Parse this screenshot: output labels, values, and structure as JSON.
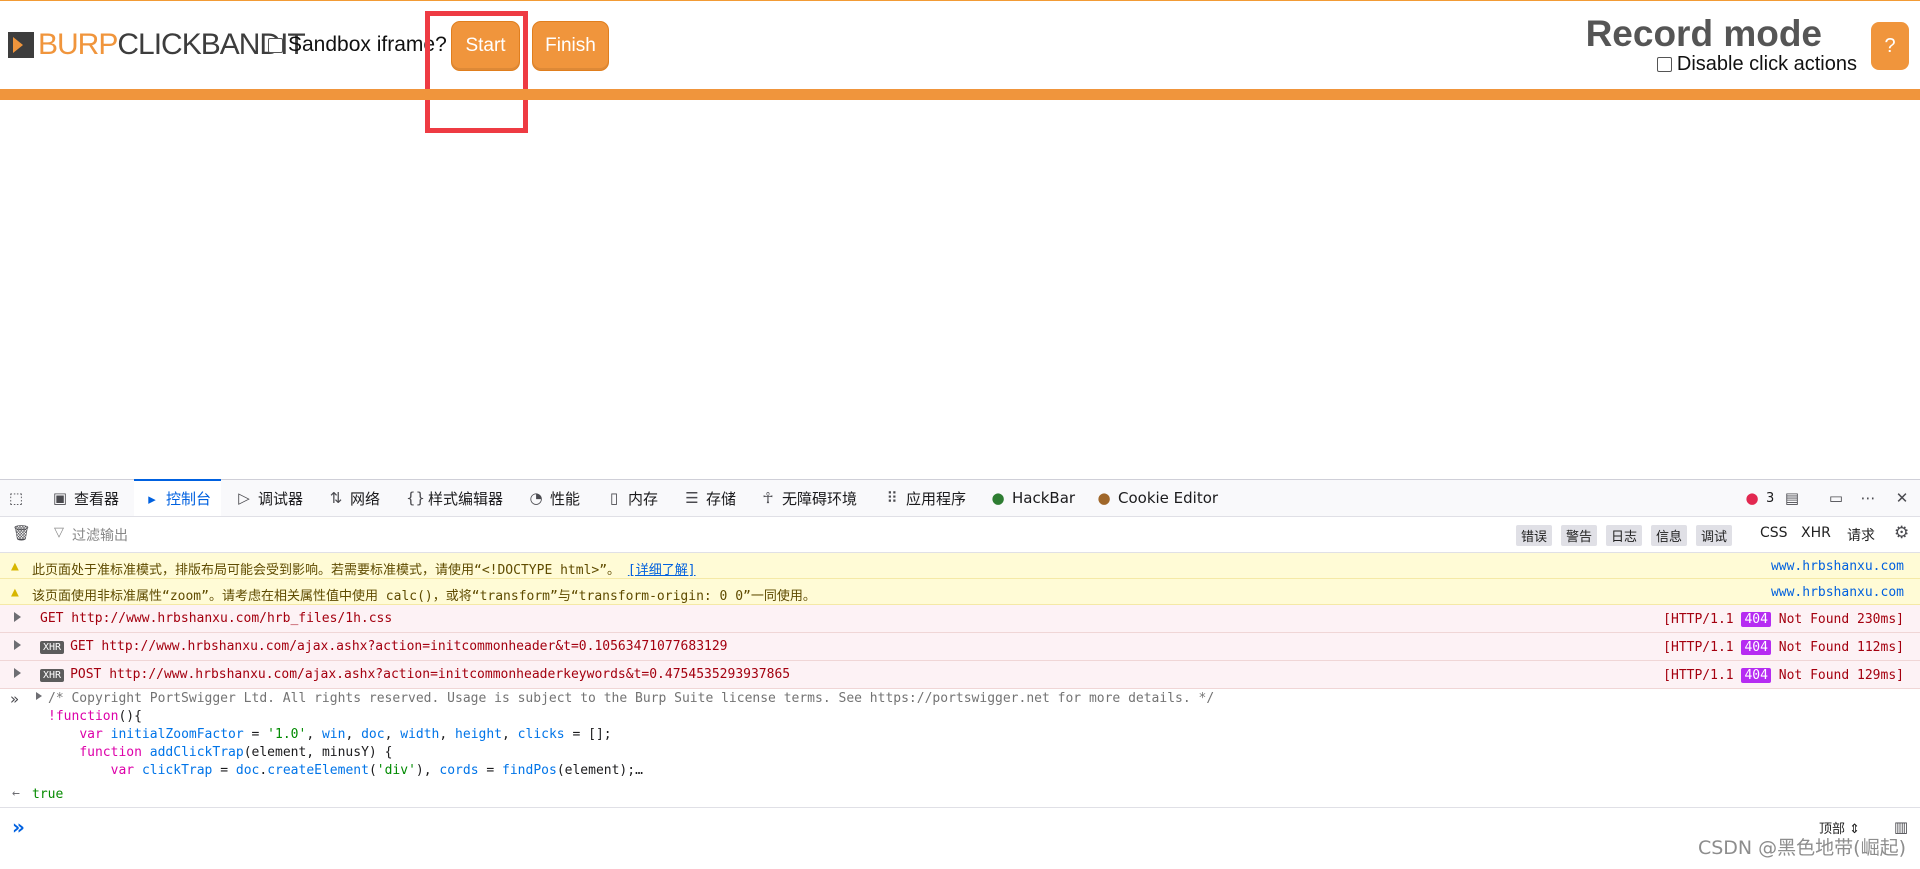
{
  "clickbandit": {
    "logo_part1": "BURP",
    "logo_part2": "CLICKBANDIT",
    "sandbox_label": "Sandbox iframe?",
    "start_label": "Start",
    "finish_label": "Finish",
    "mode_title": "Record mode",
    "disable_label": "Disable click actions",
    "help_label": "?"
  },
  "devtools": {
    "tabs": [
      "查看器",
      "控制台",
      "调试器",
      "网络",
      "样式编辑器",
      "性能",
      "内存",
      "存储",
      "无障碍环境",
      "应用程序",
      "HackBar",
      "Cookie Editor"
    ],
    "error_count": "3",
    "filter_placeholder": "过滤输出",
    "levels": [
      "错误",
      "警告",
      "日志",
      "信息",
      "调试"
    ],
    "filters": [
      "CSS",
      "XHR",
      "请求"
    ],
    "warnings": [
      {
        "text": "此页面处于准标准模式，排版布局可能会受到影响。若需要标准模式，请使用“<!DOCTYPE html>”。",
        "link": "[详细了解]",
        "source": "www.hrbshanxu.com"
      },
      {
        "text": "该页面使用非标准属性“zoom”。请考虑在相关属性值中使用 calc()，或将“transform”与“transform-origin: 0 0”一同使用。",
        "source": "www.hrbshanxu.com"
      }
    ],
    "errors": [
      {
        "badge": "",
        "text": "GET http://www.hrbshanxu.com/hrb_files/1h.css",
        "status_pre": "[HTTP/1.1",
        "code": "404",
        "status_post": "Not Found 230ms]"
      },
      {
        "badge": "XHR",
        "text": "GET http://www.hrbshanxu.com/ajax.ashx?action=initcommonheader&t=0.10563471077683129",
        "status_pre": "[HTTP/1.1",
        "code": "404",
        "status_post": "Not Found 112ms]"
      },
      {
        "badge": "XHR",
        "text": "POST http://www.hrbshanxu.com/ajax.ashx?action=initcommonheaderkeywords&t=0.4754535293937865",
        "status_pre": "[HTTP/1.1",
        "code": "404",
        "status_post": "Not Found 129ms]"
      }
    ],
    "result": "true",
    "context": "顶部",
    "watermark": "CSDN @黑色地带(崛起)"
  }
}
